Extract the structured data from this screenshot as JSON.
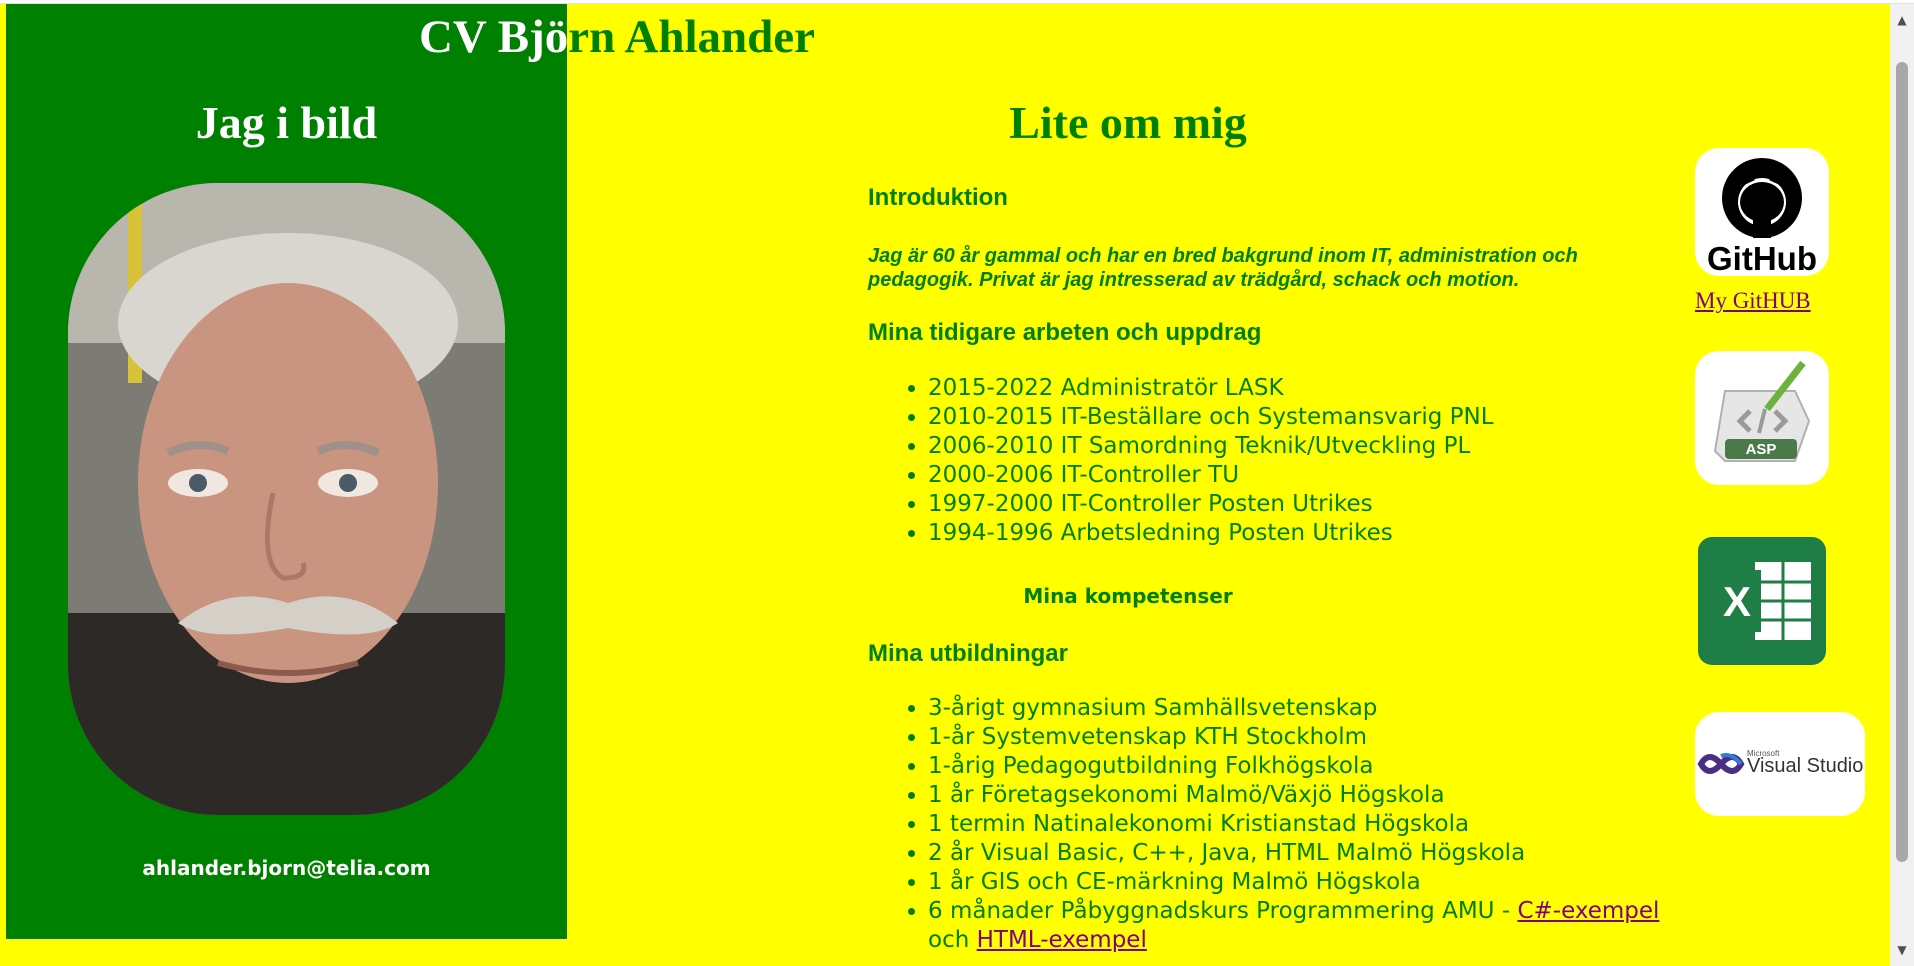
{
  "page": {
    "title": "CV Björn Ahlander"
  },
  "sidebar": {
    "heading": "Jag i bild",
    "email": "ahlander.bjorn@telia.com"
  },
  "main": {
    "heading": "Lite om mig",
    "intro_heading": "Introduktion",
    "intro_text": "Jag är 60 år gammal och har en bred bakgrund inom IT, administration och pedagogik. Privat är jag intresserad av trädgård, schack och motion.",
    "jobs_heading": "Mina tidigare arbeten och uppdrag",
    "jobs": [
      "2015-2022 Administratör LASK",
      "2010-2015 IT-Beställare och Systemansvarig PNL",
      "2006-2010 IT Samordning Teknik/Utveckling PL",
      "2000-2006 IT-Controller TU",
      "1997-2000 IT-Controller Posten Utrikes",
      "1994-1996 Arbetsledning Posten Utrikes"
    ],
    "competences_heading": "Mina kompetenser",
    "education_heading": "Mina utbildningar",
    "education": [
      "3-årigt gymnasium Samhällsvetenskap",
      "1-år Systemvetenskap KTH Stockholm",
      "1-årig Pedagogutbildning Folkhögskola",
      "1 år Företagsekonomi Malmö/Växjö Högskola",
      "1 termin Natinalekonomi Kristianstad Högskola",
      "2 år Visual Basic, C++, Java, HTML Malmö Högskola",
      "1 år GIS och CE-märkning Malmö Högskola"
    ],
    "education_last_prefix": "6 månader Påbyggnadskurs Programmering AMU - ",
    "education_last_link1": "C#-exempel",
    "education_last_mid": " och ",
    "education_last_link2": "HTML-exempel"
  },
  "logos": {
    "github_text": "GitHub",
    "github_link": "My GitHUB",
    "asp_text": "ASP",
    "excel_text": "X",
    "vs_microsoft": "Microsoft",
    "vs_text": "Visual Studio"
  },
  "colors": {
    "background": "#ffff00",
    "sidebar": "#008000",
    "text": "#008000",
    "link": "#800080"
  }
}
